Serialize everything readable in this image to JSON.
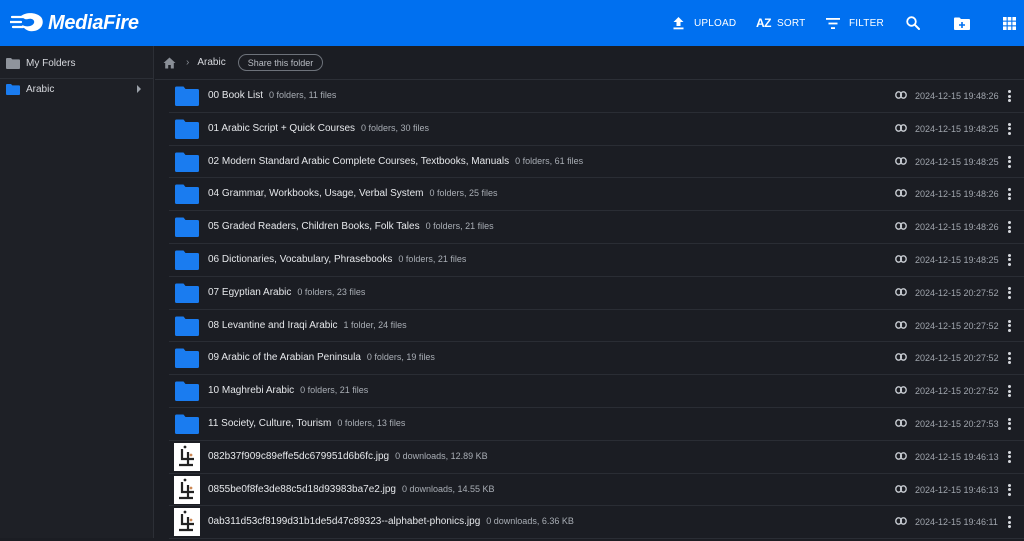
{
  "app": {
    "name": "MediaFire"
  },
  "toolbar": {
    "upload": "UPLOAD",
    "sort": "SORT",
    "sort_glyph": "AZ",
    "filter": "FILTER"
  },
  "sidebar": {
    "items": [
      {
        "label": "My Folders"
      },
      {
        "label": "Arabic"
      }
    ]
  },
  "breadcrumb": {
    "current": "Arabic",
    "share_label": "Share this folder"
  },
  "rows": [
    {
      "type": "folder",
      "name": "00 Book List",
      "meta": "0 folders, 11 files",
      "date": "2024-12-15 19:48:26"
    },
    {
      "type": "folder",
      "name": "01 Arabic Script + Quick Courses",
      "meta": "0 folders, 30 files",
      "date": "2024-12-15 19:48:25"
    },
    {
      "type": "folder",
      "name": "02 Modern Standard Arabic Complete Courses, Textbooks, Manuals",
      "meta": "0 folders, 61 files",
      "date": "2024-12-15 19:48:25"
    },
    {
      "type": "folder",
      "name": "04 Grammar, Workbooks, Usage, Verbal System",
      "meta": "0 folders, 25 files",
      "date": "2024-12-15 19:48:26"
    },
    {
      "type": "folder",
      "name": "05 Graded Readers, Children Books, Folk Tales",
      "meta": "0 folders, 21 files",
      "date": "2024-12-15 19:48:26"
    },
    {
      "type": "folder",
      "name": "06 Dictionaries, Vocabulary, Phrasebooks",
      "meta": "0 folders, 21 files",
      "date": "2024-12-15 19:48:25"
    },
    {
      "type": "folder",
      "name": "07 Egyptian Arabic",
      "meta": "0 folders, 23 files",
      "date": "2024-12-15 20:27:52"
    },
    {
      "type": "folder",
      "name": "08 Levantine and Iraqi Arabic",
      "meta": "1 folder, 24 files",
      "date": "2024-12-15 20:27:52"
    },
    {
      "type": "folder",
      "name": "09 Arabic of the Arabian Peninsula",
      "meta": "0 folders, 19 files",
      "date": "2024-12-15 20:27:52"
    },
    {
      "type": "folder",
      "name": "10 Maghrebi Arabic",
      "meta": "0 folders, 21 files",
      "date": "2024-12-15 20:27:52"
    },
    {
      "type": "folder",
      "name": "11 Society, Culture, Tourism",
      "meta": "0 folders, 13 files",
      "date": "2024-12-15 20:27:53"
    },
    {
      "type": "image",
      "name": "082b37f909c89effe5dc679951d6b6fc.jpg",
      "meta": "0 downloads, 12.89 KB",
      "date": "2024-12-15 19:46:13"
    },
    {
      "type": "image",
      "name": "0855be0f8fe3de88c5d18d93983ba7e2.jpg",
      "meta": "0 downloads, 14.55 KB",
      "date": "2024-12-15 19:46:13"
    },
    {
      "type": "image",
      "name": "0ab311d53cf8199d31b1de5d47c89323--alphabet-phonics.jpg",
      "meta": "0 downloads, 6.36 KB",
      "date": "2024-12-15 19:46:11"
    }
  ],
  "colors": {
    "brand": "#0070f0",
    "folder": "#1a7cf0",
    "background": "#1b1d23"
  },
  "icons": [
    "mediafire-logo",
    "upload-icon",
    "sort-icon",
    "filter-icon",
    "search-icon",
    "new-folder-icon",
    "grid-view-icon",
    "home-icon",
    "folder-icon",
    "link-icon",
    "more-icon"
  ]
}
